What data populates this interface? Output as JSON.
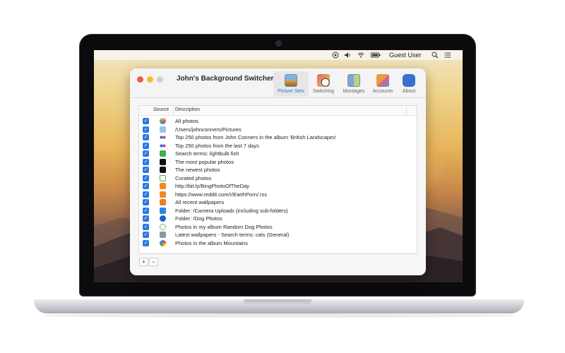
{
  "menubar": {
    "user": "Guest User",
    "icons": [
      "accessibility-icon",
      "volume-icon",
      "wifi-icon",
      "battery-icon",
      "search-icon",
      "control-center-icon"
    ]
  },
  "window": {
    "title": "John's Background Switcher",
    "toolbar": [
      {
        "label": "Picture Sets",
        "icon": "picture-sets-icon",
        "active": true
      },
      {
        "label": "Switching",
        "icon": "switching-clock-icon",
        "active": false
      },
      {
        "label": "Montages",
        "icon": "montages-icon",
        "active": false
      },
      {
        "label": "Accounts",
        "icon": "accounts-icon",
        "active": false
      },
      {
        "label": "About",
        "icon": "about-icon",
        "active": false
      }
    ],
    "table": {
      "columns": [
        "Source",
        "Description"
      ],
      "rows": [
        {
          "checked": true,
          "source_icon": "photos-icon",
          "description": "All photos"
        },
        {
          "checked": true,
          "source_icon": "folder-icon",
          "description": "/Users/johnconners/Pictures"
        },
        {
          "checked": true,
          "source_icon": "flickr-icon",
          "description": "Top 250 photos from John Conners in the album 'British Landscapes'"
        },
        {
          "checked": true,
          "source_icon": "flickr-icon",
          "description": "Top 250 photos from the last 7 days"
        },
        {
          "checked": true,
          "source_icon": "unsplash-icon",
          "description": "Search terms: lightbulb fish"
        },
        {
          "checked": true,
          "source_icon": "500px-icon",
          "description": "The most popular photos"
        },
        {
          "checked": true,
          "source_icon": "500px-icon",
          "description": "The newest photos"
        },
        {
          "checked": true,
          "source_icon": "curated-icon",
          "description": "Curated photos"
        },
        {
          "checked": true,
          "source_icon": "rss-icon",
          "description": "http://bit.ly/BingPhotoOfTheDay"
        },
        {
          "checked": true,
          "source_icon": "rss-icon",
          "description": "https://www.reddit.com/r/EarthPorn/.rss"
        },
        {
          "checked": true,
          "source_icon": "wallpapers-icon",
          "description": "All recent wallpapers"
        },
        {
          "checked": true,
          "source_icon": "dropbox-icon",
          "description": "Folder: /Camera Uploads (including sub-folders)"
        },
        {
          "checked": true,
          "source_icon": "onedrive-icon",
          "description": "Folder: /Dog Photos"
        },
        {
          "checked": true,
          "source_icon": "dog-icon",
          "description": "Photos in my album Random Dog Photos"
        },
        {
          "checked": true,
          "source_icon": "wallhaven-icon",
          "description": "Latest wallpapers - Search terms: cats (General)"
        },
        {
          "checked": true,
          "source_icon": "google-photos-icon",
          "description": "Photos in the album Mountains"
        }
      ]
    },
    "add_label": "+",
    "remove_label": "−"
  },
  "colors": {
    "accent": "#2a7ae2",
    "close": "#ee5a52",
    "minimize": "#f4bd35",
    "zoom": "#d0d0d0"
  }
}
